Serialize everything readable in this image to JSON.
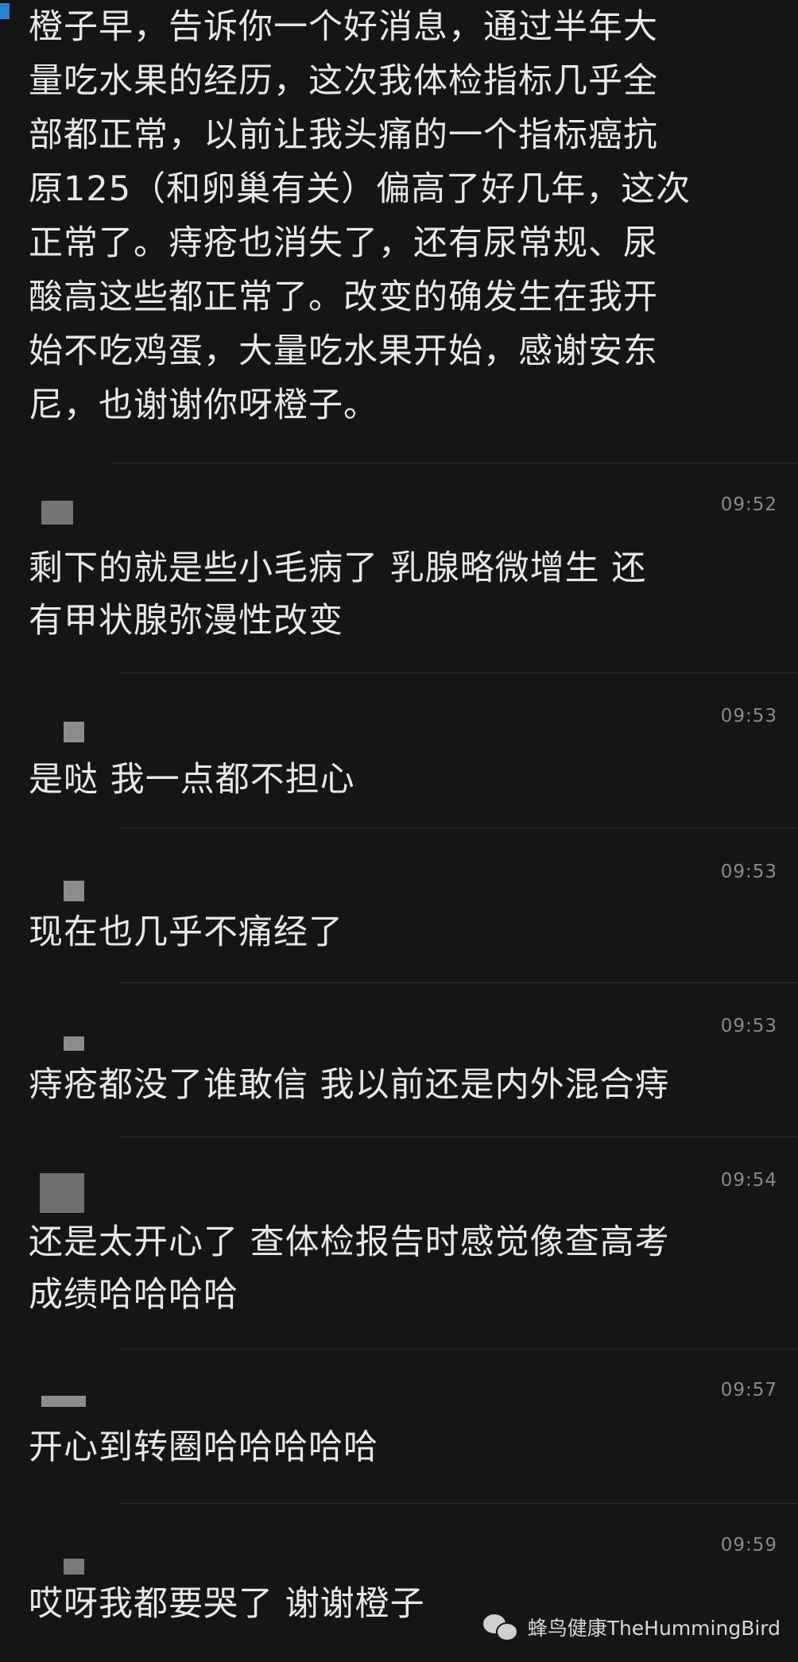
{
  "first_message": {
    "lines": [
      "橙子早，告诉你一个好消息，通过半年大",
      "量吃水果的经历，这次我体检指标几乎全",
      "部都正常，以前让我头痛的一个指标癌抗",
      "原125（和卵巢有关）偏高了好几年，这次",
      "正常了。痔疮也消失了，还有尿常规、尿",
      "酸高这些都正常了。改变的确发生在我开",
      "始不吃鸡蛋，大量吃水果开始，感谢安东",
      "尼，也谢谢你呀橙子。"
    ]
  },
  "messages": [
    {
      "time": "09:52",
      "lines": [
        "剩下的就是些小毛病了  乳腺略微增生  还",
        "有甲状腺弥漫性改变"
      ]
    },
    {
      "time": "09:53",
      "lines": [
        "是哒  我一点都不担心"
      ]
    },
    {
      "time": "09:53",
      "lines": [
        "现在也几乎不痛经了"
      ]
    },
    {
      "time": "09:53",
      "lines": [
        "痔疮都没了谁敢信  我以前还是内外混合痔"
      ]
    },
    {
      "time": "09:54",
      "lines": [
        "还是太开心了  查体检报告时感觉像查高考",
        "成绩哈哈哈哈"
      ]
    },
    {
      "time": "09:57",
      "lines": [
        "开心到转圈哈哈哈哈哈"
      ]
    },
    {
      "time": "09:59",
      "lines": [
        "哎呀我都要哭了  谢谢橙子"
      ]
    }
  ],
  "watermark": {
    "text": "蜂鸟健康TheHummingBird",
    "icon": "wechat-icon"
  }
}
